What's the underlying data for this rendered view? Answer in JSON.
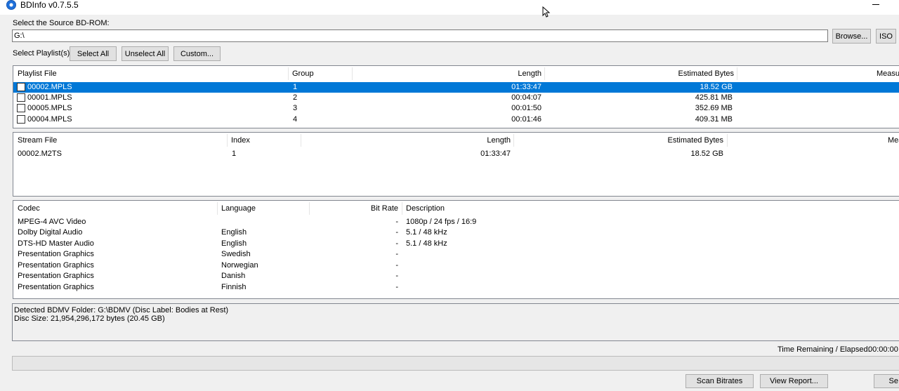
{
  "window": {
    "title": "BDInfo v0.7.5.5"
  },
  "source": {
    "label": "Select the Source BD-ROM:",
    "path": "G:\\",
    "browse_label": "Browse...",
    "iso_label": "ISO"
  },
  "playlist_controls": {
    "label": "Select Playlist(s):",
    "select_all": "Select All",
    "unselect_all": "Unselect All",
    "custom": "Custom..."
  },
  "playlists": {
    "columns": [
      "Playlist File",
      "Group",
      "Length",
      "Estimated Bytes",
      "Measure"
    ],
    "rows": [
      {
        "file": "00002.MPLS",
        "group": "1",
        "length": "01:33:47",
        "bytes": "18.52 GB",
        "selected": true
      },
      {
        "file": "00001.MPLS",
        "group": "2",
        "length": "00:04:07",
        "bytes": "425.81 MB",
        "selected": false
      },
      {
        "file": "00005.MPLS",
        "group": "3",
        "length": "00:01:50",
        "bytes": "352.69 MB",
        "selected": false
      },
      {
        "file": "00004.MPLS",
        "group": "4",
        "length": "00:01:46",
        "bytes": "409.31 MB",
        "selected": false
      }
    ]
  },
  "streams": {
    "columns": [
      "Stream File",
      "Index",
      "Length",
      "Estimated Bytes",
      "Mea"
    ],
    "rows": [
      {
        "file": "00002.M2TS",
        "index": "1",
        "length": "01:33:47",
        "bytes": "18.52 GB"
      }
    ]
  },
  "codecs": {
    "columns": [
      "Codec",
      "Language",
      "Bit Rate",
      "Description"
    ],
    "rows": [
      {
        "codec": "MPEG-4 AVC Video",
        "language": "",
        "bitrate": "-",
        "description": "1080p / 24 fps / 16:9"
      },
      {
        "codec": "Dolby Digital Audio",
        "language": "English",
        "bitrate": "-",
        "description": "5.1 / 48 kHz"
      },
      {
        "codec": "DTS-HD Master Audio",
        "language": "English",
        "bitrate": "-",
        "description": "5.1 / 48 kHz"
      },
      {
        "codec": "Presentation Graphics",
        "language": "Swedish",
        "bitrate": "-",
        "description": ""
      },
      {
        "codec": "Presentation Graphics",
        "language": "Norwegian",
        "bitrate": "-",
        "description": ""
      },
      {
        "codec": "Presentation Graphics",
        "language": "Danish",
        "bitrate": "-",
        "description": ""
      },
      {
        "codec": "Presentation Graphics",
        "language": "Finnish",
        "bitrate": "-",
        "description": ""
      }
    ]
  },
  "info": {
    "line1": "Detected BDMV Folder: G:\\BDMV (Disc Label: Bodies at Rest)",
    "line2": "Disc Size: 21,954,296,172 bytes (20.45 GB)"
  },
  "status": {
    "time_label": "Time Remaining / Elapsed:",
    "time_value": "00:00:00",
    "progress": 0
  },
  "footer": {
    "scan_bitrates": "Scan Bitrates",
    "view_report": "View Report...",
    "third_partial": "Se"
  }
}
